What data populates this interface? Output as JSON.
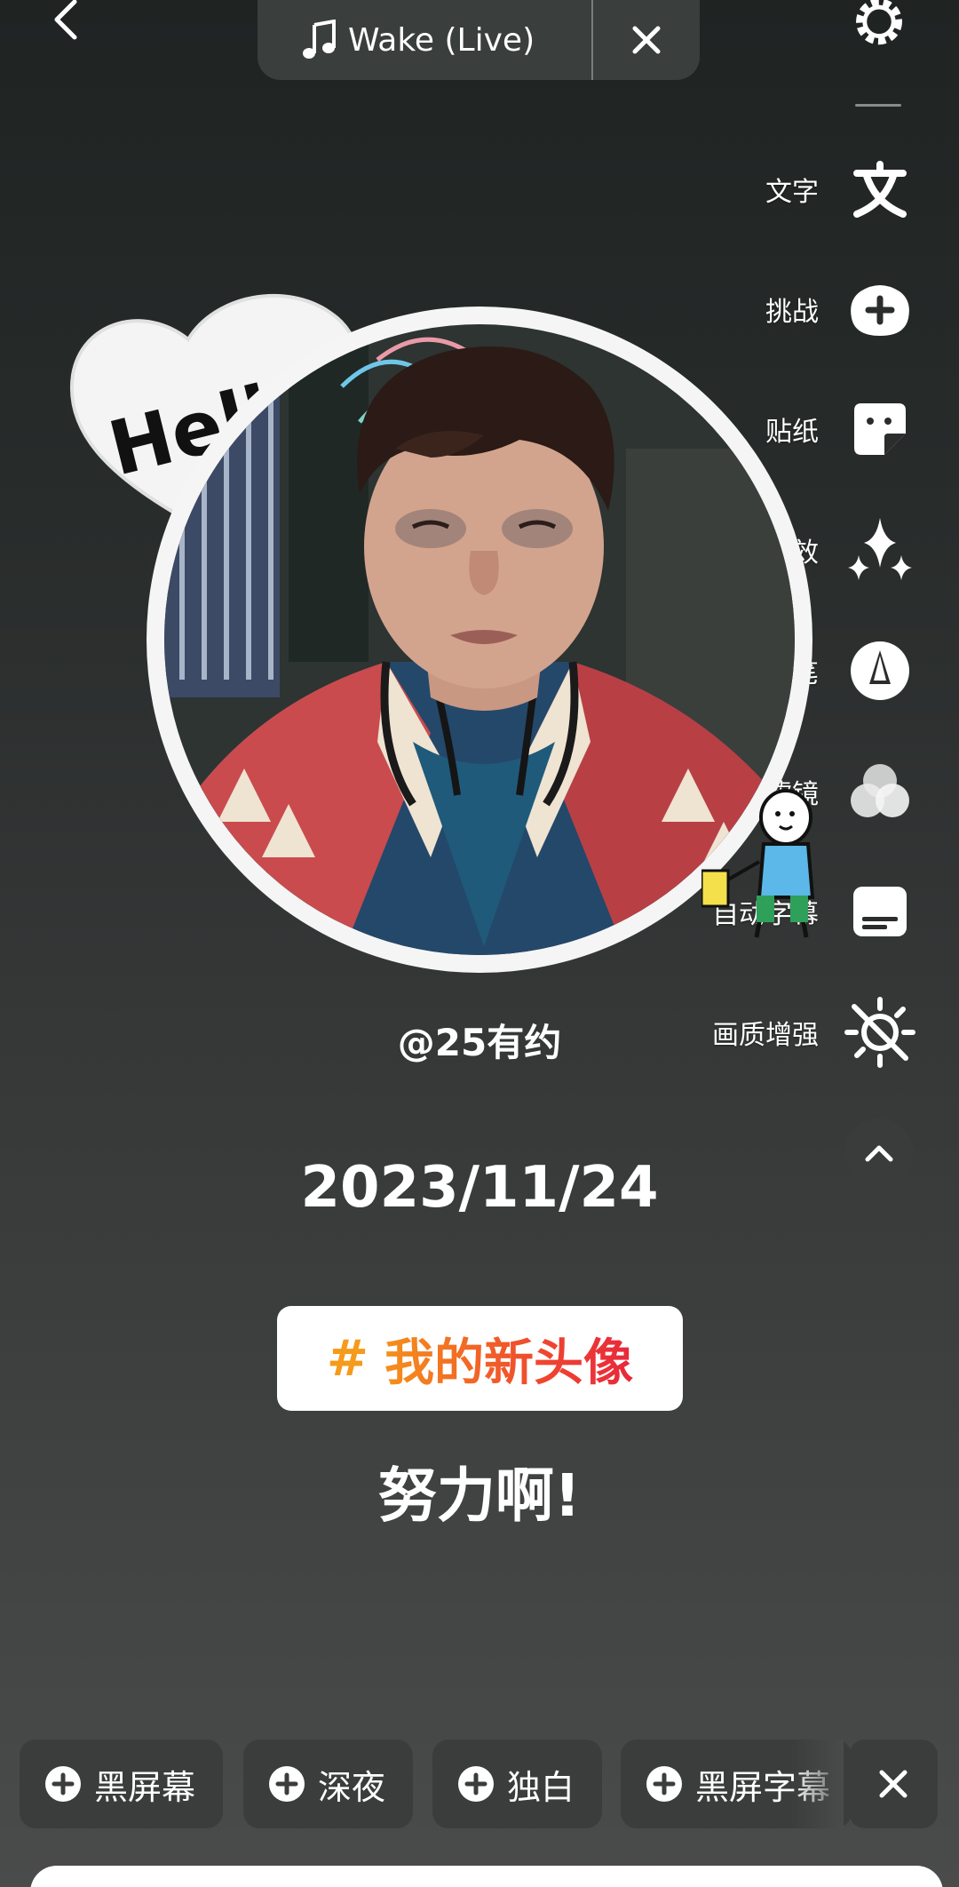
{
  "header": {
    "music_title": "Wake (Live)"
  },
  "tools": [
    {
      "label": "文字",
      "icon": "text-icon"
    },
    {
      "label": "挑战",
      "icon": "challenge-icon"
    },
    {
      "label": "贴纸",
      "icon": "sticker-icon"
    },
    {
      "label": "特效",
      "icon": "effects-sparkle-icon"
    },
    {
      "label": "画笔",
      "icon": "brush-icon"
    },
    {
      "label": "滤镜",
      "icon": "filter-icon"
    },
    {
      "label": "自动字幕",
      "icon": "auto-caption-icon"
    },
    {
      "label": "画质增强",
      "icon": "enhance-off-icon"
    }
  ],
  "canvas": {
    "sticker_text": "Hello",
    "username": "@25有约",
    "date": "2023/11/24",
    "hashtag_symbol": "#",
    "hashtag": "我的新头像",
    "caption": "努力啊!"
  },
  "chips": [
    {
      "label": "黑屏幕"
    },
    {
      "label": "深夜"
    },
    {
      "label": "独白"
    },
    {
      "label": "黑屏字幕"
    }
  ],
  "colors": {
    "hashtag_orange": "#f59a1b",
    "hashtag_red": "#e8273b",
    "chip_bg": "#3b3d3d"
  }
}
